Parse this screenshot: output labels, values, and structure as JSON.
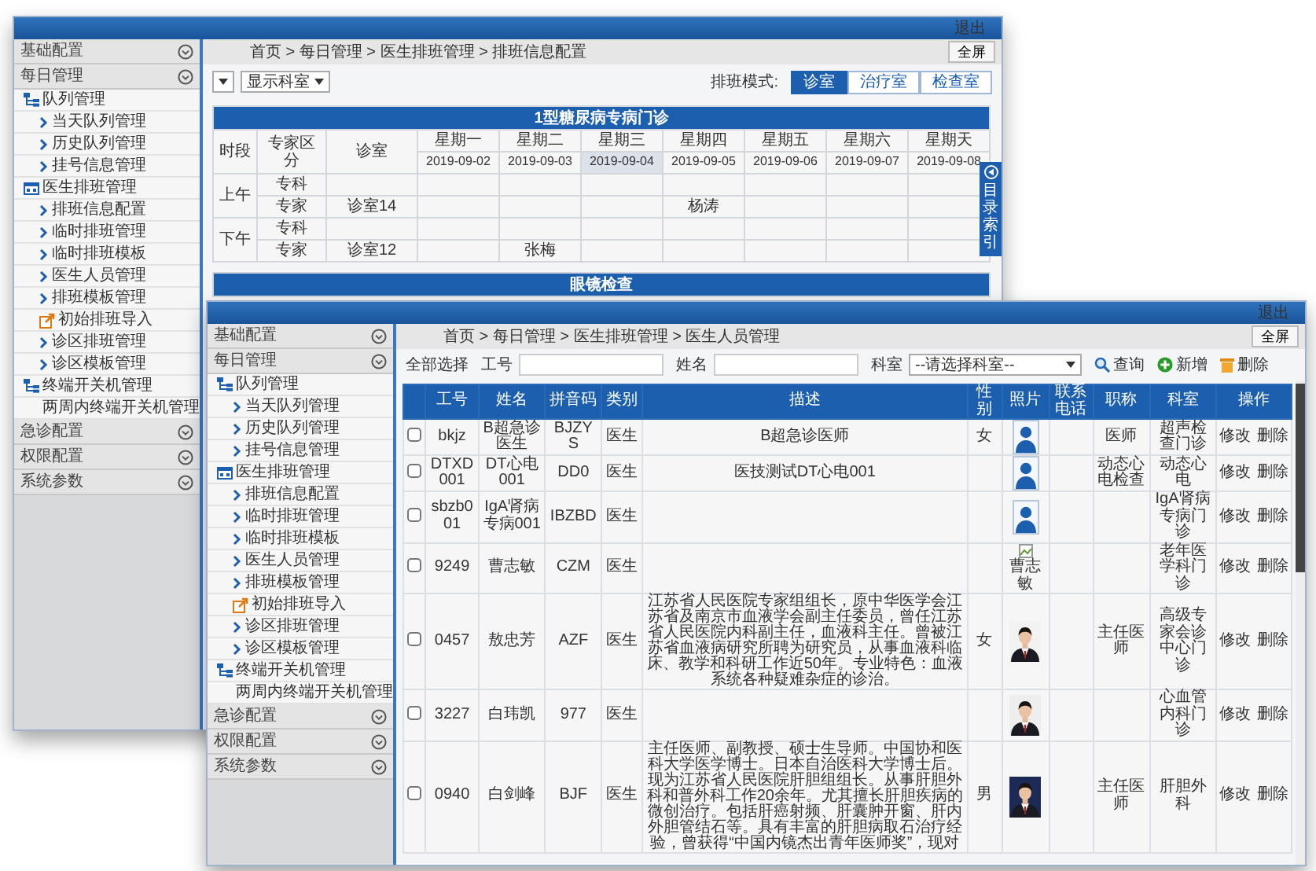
{
  "back_window": {
    "logout": "退出",
    "sidebar": [
      {
        "label": "基础配置"
      },
      {
        "label": "每日管理",
        "items": [
          {
            "label": "队列管理",
            "kind": "tree",
            "children": [
              {
                "label": "当天队列管理",
                "kind": "page"
              },
              {
                "label": "历史队列管理",
                "kind": "page"
              },
              {
                "label": "挂号信息管理",
                "kind": "page"
              }
            ]
          },
          {
            "label": "医生排班管理",
            "kind": "calendar",
            "children": [
              {
                "label": "排班信息配置",
                "kind": "page"
              },
              {
                "label": "临时排班管理",
                "kind": "page"
              },
              {
                "label": "临时排班模板",
                "kind": "page"
              },
              {
                "label": "医生人员管理",
                "kind": "page"
              },
              {
                "label": "排班模板管理",
                "kind": "page"
              },
              {
                "label": "初始排班导入",
                "kind": "import"
              },
              {
                "label": "诊区排班管理",
                "kind": "page"
              },
              {
                "label": "诊区模板管理",
                "kind": "page"
              }
            ]
          },
          {
            "label": "终端开关机管理",
            "kind": "tree",
            "children": [
              {
                "label": "两周内终端开关机管理",
                "kind": "calendar"
              }
            ]
          }
        ]
      },
      {
        "label": "急诊配置"
      },
      {
        "label": "权限配置"
      },
      {
        "label": "系统参数"
      }
    ],
    "breadcrumb": "首页 > 每日管理 > 医生排班管理 > 排班信息配置",
    "fullscreen": "全屏",
    "dept_select": "显示科室",
    "mode_label": "排班模式:",
    "modes": [
      {
        "label": "诊室",
        "selected": true
      },
      {
        "label": "治疗室",
        "selected": false
      },
      {
        "label": "检查室",
        "selected": false
      }
    ],
    "side_tab": "目录索引",
    "schedules": [
      {
        "title": "1型糖尿病专病门诊",
        "columns": [
          "时段",
          "专家区分",
          "诊室"
        ],
        "days": [
          {
            "day": "星期一",
            "date": "2019-09-02",
            "selected": false
          },
          {
            "day": "星期二",
            "date": "2019-09-03",
            "selected": false
          },
          {
            "day": "星期三",
            "date": "2019-09-04",
            "selected": true
          },
          {
            "day": "星期四",
            "date": "2019-09-05",
            "selected": false
          },
          {
            "day": "星期五",
            "date": "2019-09-06",
            "selected": false
          },
          {
            "day": "星期六",
            "date": "2019-09-07",
            "selected": false
          },
          {
            "day": "星期天",
            "date": "2019-09-08",
            "selected": false
          }
        ],
        "periods": [
          {
            "label": "上午",
            "rows": [
              {
                "type": "专科"
              },
              {
                "type": "专家",
                "room": "诊室14",
                "cells": [
                  null,
                  null,
                  null,
                  "杨涛",
                  null,
                  null,
                  null
                ]
              }
            ]
          },
          {
            "label": "下午",
            "rows": [
              {
                "type": "专科"
              },
              {
                "type": "专家",
                "room": "诊室12",
                "cells": [
                  null,
                  "张梅",
                  null,
                  null,
                  null,
                  null,
                  null
                ]
              }
            ]
          }
        ]
      },
      {
        "title": "眼镜检查"
      }
    ]
  },
  "front_window": {
    "logout": "退出",
    "sidebar": [
      {
        "label": "基础配置"
      },
      {
        "label": "每日管理",
        "items": [
          {
            "label": "队列管理",
            "kind": "tree",
            "children": [
              {
                "label": "当天队列管理",
                "kind": "page"
              },
              {
                "label": "历史队列管理",
                "kind": "page"
              },
              {
                "label": "挂号信息管理",
                "kind": "page"
              }
            ]
          },
          {
            "label": "医生排班管理",
            "kind": "calendar",
            "children": [
              {
                "label": "排班信息配置",
                "kind": "page"
              },
              {
                "label": "临时排班管理",
                "kind": "page"
              },
              {
                "label": "临时排班模板",
                "kind": "page"
              },
              {
                "label": "医生人员管理",
                "kind": "page"
              },
              {
                "label": "排班模板管理",
                "kind": "page"
              },
              {
                "label": "初始排班导入",
                "kind": "import"
              },
              {
                "label": "诊区排班管理",
                "kind": "page"
              },
              {
                "label": "诊区模板管理",
                "kind": "page"
              }
            ]
          },
          {
            "label": "终端开关机管理",
            "kind": "tree",
            "children": [
              {
                "label": "两周内终端开关机管理",
                "kind": "calendar"
              }
            ]
          }
        ]
      },
      {
        "label": "急诊配置"
      },
      {
        "label": "权限配置"
      },
      {
        "label": "系统参数"
      }
    ],
    "breadcrumb": "首页 > 每日管理 > 医生排班管理 > 医生人员管理",
    "fullscreen": "全屏",
    "select_all": "全部选择",
    "fields": [
      {
        "label": "工号"
      },
      {
        "label": "姓名"
      }
    ],
    "dept": {
      "label": "科室",
      "value": "--请选择科室--"
    },
    "actions": [
      {
        "kind": "search",
        "label": "查询"
      },
      {
        "kind": "add",
        "label": "新增"
      },
      {
        "kind": "delete",
        "label": "删除"
      }
    ],
    "table": {
      "columns": [
        "工号",
        "姓名",
        "拼音码",
        "类别",
        "描述",
        "性别",
        "照片",
        "联系电话",
        "职称",
        "科室",
        "操作"
      ],
      "rows": [
        {
          "checked": false,
          "id": "bkjz",
          "name": "B超急诊医生",
          "code": "BJZYS",
          "category": "医生",
          "description": "B超急诊医师",
          "gender": "女",
          "photo": {
            "kind": "avatar"
          },
          "title": "医师",
          "dept": "超声检查门诊",
          "actions": [
            "修改",
            "删除"
          ]
        },
        {
          "checked": false,
          "id": "DTXD001",
          "name": "DT心电001",
          "code": "DD0",
          "category": "医生",
          "description": "医技测试DT心电001",
          "photo": {
            "kind": "avatar"
          },
          "title": "动态心电检查",
          "dept": "动态心电",
          "actions": [
            "修改",
            "删除"
          ]
        },
        {
          "checked": false,
          "id": "sbzb001",
          "name": "IgA肾病专病001",
          "code": "IBZBD",
          "category": "医生",
          "photo": {
            "kind": "avatar"
          },
          "dept": "IgA肾病专病门诊",
          "actions": [
            "修改",
            "删除"
          ]
        },
        {
          "checked": false,
          "id": "9249",
          "name": "曹志敏",
          "code": "CZM",
          "category": "医生",
          "photo": {
            "kind": "broken",
            "alt": "曹志敏"
          },
          "dept": "老年医学科门诊",
          "actions": [
            "修改",
            "删除"
          ]
        },
        {
          "checked": false,
          "id": "0457",
          "name": "敖忠芳",
          "code": "AZF",
          "category": "医生",
          "description": "江苏省人民医院专家组组长，原中华医学会江苏省及南京市血液学会副主任委员，曾任江苏省人民医院内科副主任，血液科主任。曾被江苏省血液病研究所聘为研究员，从事血液科临床、教学和科研工作近50年。专业特色：血液系统各种疑难杂症的诊治。",
          "gender": "女",
          "photo": {
            "kind": "picture"
          },
          "title": "主任医师",
          "dept": "高级专家会诊中心门诊",
          "actions": [
            "修改",
            "删除"
          ]
        },
        {
          "checked": false,
          "id": "3227",
          "name": "白玮凯",
          "code": "977",
          "category": "医生",
          "photo": {
            "kind": "picture"
          },
          "dept": "心血管内科门诊",
          "actions": [
            "修改",
            "删除"
          ]
        },
        {
          "checked": false,
          "id": "0940",
          "name": "白剑峰",
          "code": "BJF",
          "category": "医生",
          "description": "主任医师、副教授、硕士生导师。中国协和医科大学医学博士。日本自治医科大学博士后。现为江苏省人民医院肝胆组组长。从事肝胆外科和普外科工作20余年。尤其擅长肝胆疾病的微创治疗。包括肝癌射频、肝囊肿开窗、肝内外胆管结石等。具有丰富的肝胆病取石治疗经验，曾获得“中国内镜杰出青年医师奖”，现对",
          "gender": "男",
          "photo": {
            "kind": "picture"
          },
          "title": "主任医师",
          "dept": "肝胆外科",
          "actions": [
            "修改",
            "删除"
          ]
        }
      ]
    }
  }
}
